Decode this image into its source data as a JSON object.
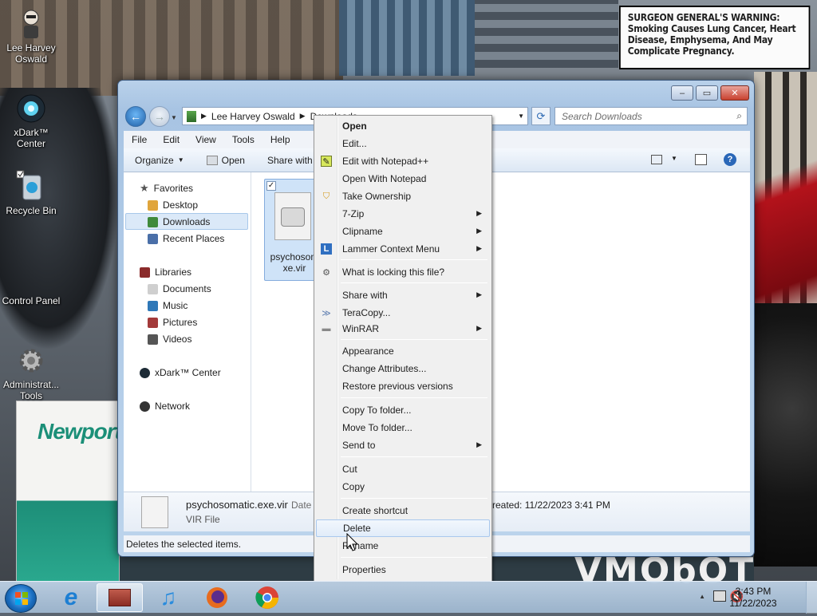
{
  "wallpaper": {
    "warning_title": "SURGEON GENERAL'S WARNING:",
    "warning_text": "Smoking Causes Lung Cancer, Heart Disease, Emphysema, And May Complicate Pregnancy.",
    "cig_brand": "Newport",
    "vmobot_text": "VMObOT"
  },
  "desktop_icons": [
    {
      "label": "Lee Harvey Oswald"
    },
    {
      "label": "xDark™ Center"
    },
    {
      "label": "Recycle Bin"
    },
    {
      "label": "Control Panel"
    },
    {
      "label": "Administrat... Tools"
    }
  ],
  "explorer": {
    "breadcrumb": [
      "Lee Harvey Oswald",
      "Downloads"
    ],
    "search_placeholder": "Search Downloads",
    "menu": [
      "File",
      "Edit",
      "View",
      "Tools",
      "Help"
    ],
    "toolbar": {
      "organize": "Organize",
      "open": "Open",
      "share_with": "Share with"
    },
    "nav": {
      "favorites": "Favorites",
      "desktop": "Desktop",
      "downloads": "Downloads",
      "recent": "Recent Places",
      "libraries": "Libraries",
      "documents": "Documents",
      "music": "Music",
      "pictures": "Pictures",
      "videos": "Videos",
      "xdark": "xDark™ Center",
      "network": "Network"
    },
    "file": {
      "name_line1": "psychosom",
      "name_line2": "xe.vir"
    },
    "details": {
      "filename": "psychosomatic.exe.vir",
      "date_label": "Date m",
      "filetype": "VIR File",
      "created": "reated: 11/22/2023 3:41 PM"
    },
    "status": "Deletes the selected items."
  },
  "context_menu": {
    "items": [
      {
        "label": "Open",
        "bold": true
      },
      {
        "label": "Edit..."
      },
      {
        "label": "Edit with Notepad++"
      },
      {
        "label": "Open With Notepad"
      },
      {
        "label": "Take Ownership"
      },
      {
        "label": "7-Zip",
        "submenu": true
      },
      {
        "label": "Clipname",
        "submenu": true
      },
      {
        "label": "Lammer Context Menu",
        "submenu": true
      },
      {
        "label": "What is locking this file?"
      },
      {
        "label": "Share with",
        "submenu": true
      },
      {
        "label": "TeraCopy..."
      },
      {
        "label": "WinRAR",
        "submenu": true
      },
      {
        "label": "Appearance"
      },
      {
        "label": "Change Attributes..."
      },
      {
        "label": "Restore previous versions"
      },
      {
        "label": "Copy To folder..."
      },
      {
        "label": "Move To folder..."
      },
      {
        "label": "Send to",
        "submenu": true
      },
      {
        "label": "Cut"
      },
      {
        "label": "Copy"
      },
      {
        "label": "Create shortcut"
      },
      {
        "label": "Delete",
        "highlighted": true
      },
      {
        "label": "Rename"
      },
      {
        "label": "Properties"
      }
    ]
  },
  "taskbar": {
    "time": "3:43 PM",
    "date": "11/22/2023"
  },
  "colors": {
    "accent": "#3d5a80",
    "highlight": "#dbe9f8"
  }
}
